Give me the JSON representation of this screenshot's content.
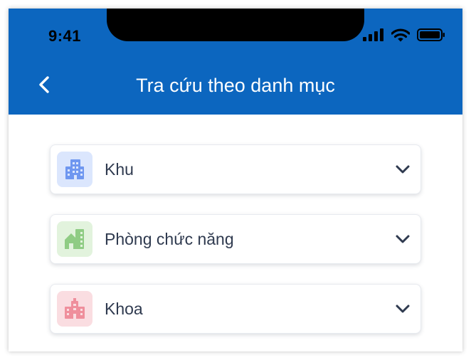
{
  "status_bar": {
    "time": "9:41"
  },
  "header": {
    "title": "Tra cứu theo danh mục"
  },
  "categories": [
    {
      "label": "Khu",
      "icon": "building-icon",
      "icon_bg": "#dbe6fd",
      "icon_color": "#6f97f0"
    },
    {
      "label": "Phòng chức năng",
      "icon": "home-building-icon",
      "icon_bg": "#e2f3dd",
      "icon_color": "#8fcc84"
    },
    {
      "label": "Khoa",
      "icon": "department-building-icon",
      "icon_bg": "#fadde1",
      "icon_color": "#ef8f9c"
    }
  ],
  "colors": {
    "header_bg": "#0c66bf",
    "label_text": "#2f3a4f",
    "chevron": "#2f3a4f"
  }
}
